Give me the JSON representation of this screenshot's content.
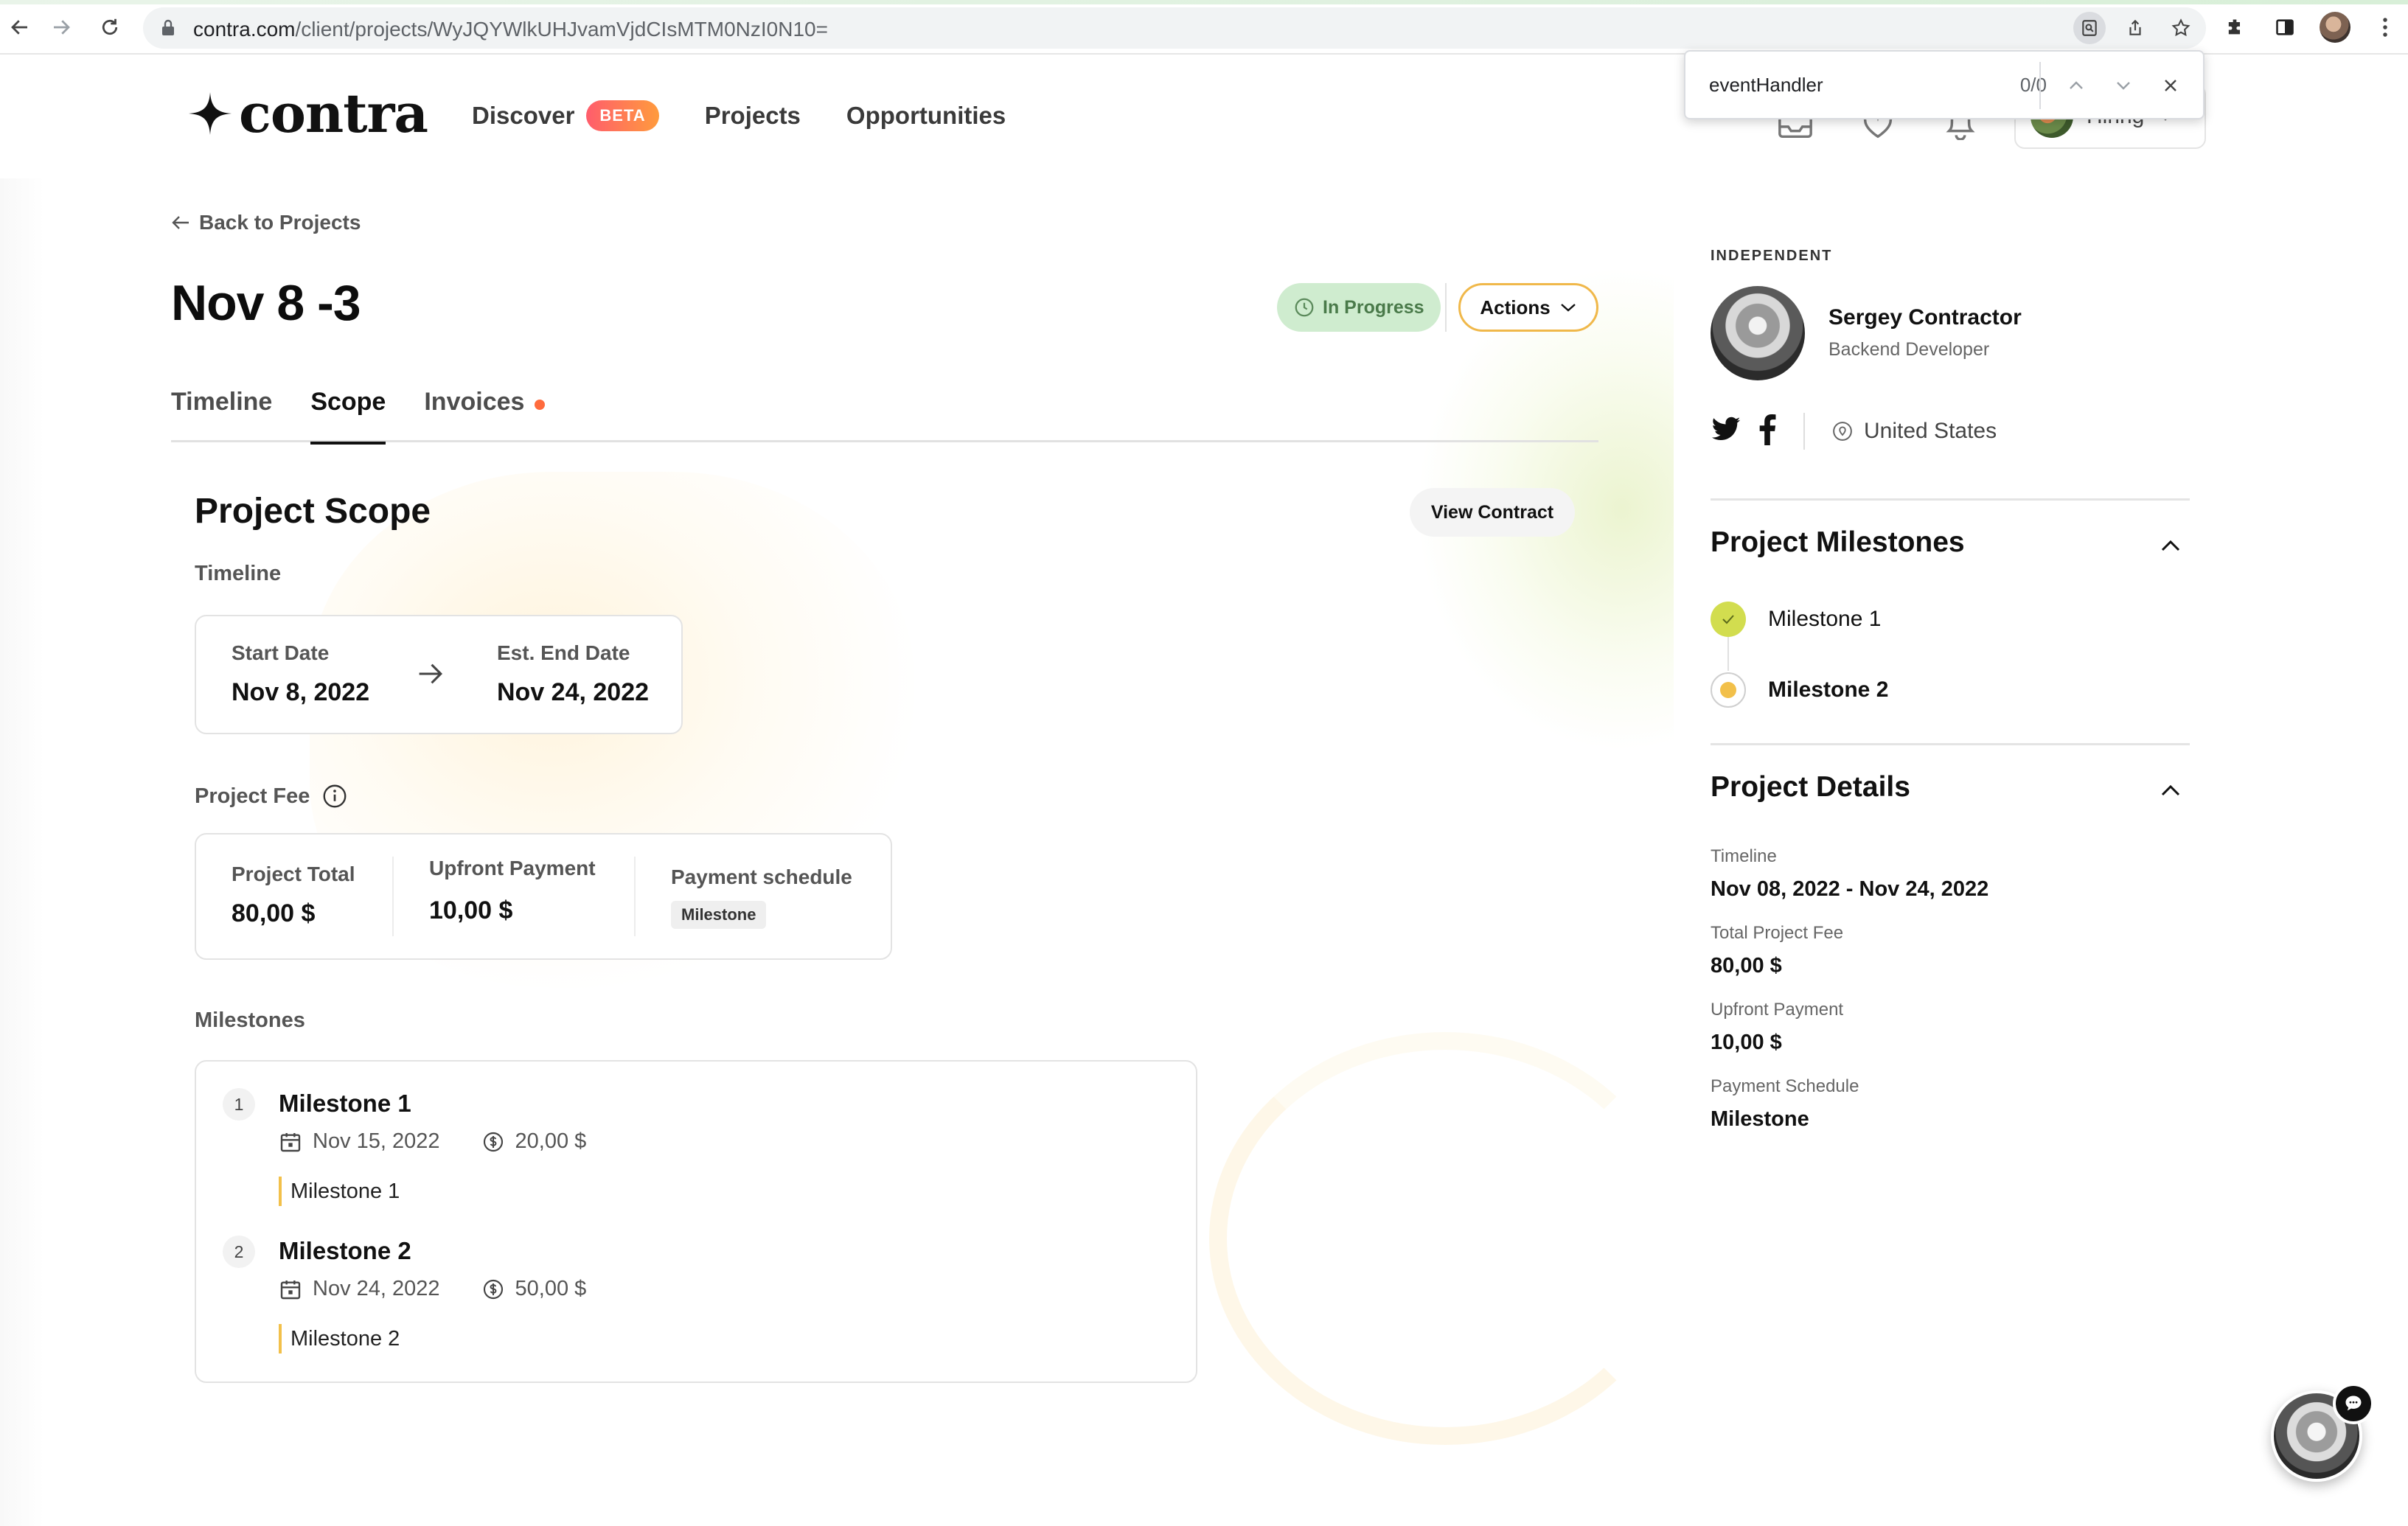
{
  "browser": {
    "url_host": "contra.com",
    "url_path": "/client/projects/WyJQYWlkUHJvamVjdCIsMTM0NzI0N10="
  },
  "find_bar": {
    "query": "eventHandler",
    "count": "0/0"
  },
  "header": {
    "logo_text": "contra",
    "nav": {
      "discover": "Discover",
      "beta": "BETA",
      "projects": "Projects",
      "opportunities": "Opportunities"
    },
    "account_label": "Hiring"
  },
  "page": {
    "back_link": "Back to Projects",
    "title": "Nov 8 -3",
    "status": "In Progress",
    "actions": "Actions",
    "tabs": [
      "Timeline",
      "Scope",
      "Invoices"
    ],
    "active_tab": "Scope"
  },
  "scope": {
    "title": "Project Scope",
    "view_contract": "View Contract",
    "timeline_label": "Timeline",
    "start_label": "Start Date",
    "start_value": "Nov 8, 2022",
    "end_label": "Est. End Date",
    "end_value": "Nov 24, 2022",
    "fee_label": "Project Fee",
    "total_label": "Project Total",
    "total_value": "80,00 $",
    "upfront_label": "Upfront Payment",
    "upfront_value": "10,00 $",
    "schedule_label": "Payment schedule",
    "schedule_value": "Milestone",
    "milestones_label": "Milestones",
    "milestones": [
      {
        "num": "1",
        "title": "Milestone 1",
        "date": "Nov 15, 2022",
        "amount": "20,00 $",
        "desc": "Milestone 1"
      },
      {
        "num": "2",
        "title": "Milestone 2",
        "date": "Nov 24, 2022",
        "amount": "50,00 $",
        "desc": "Milestone 2"
      }
    ]
  },
  "sidebar": {
    "independent": "INDEPENDENT",
    "name": "Sergey Contractor",
    "role": "Backend Developer",
    "location": "United States",
    "milestones_title": "Project Milestones",
    "milestones": [
      {
        "label": "Milestone 1",
        "state": "done"
      },
      {
        "label": "Milestone 2",
        "state": "current"
      }
    ],
    "details_title": "Project Details",
    "details": [
      {
        "label": "Timeline",
        "value": "Nov 08, 2022 - Nov 24, 2022"
      },
      {
        "label": "Total Project Fee",
        "value": "80,00 $"
      },
      {
        "label": "Upfront Payment",
        "value": "10,00 $"
      },
      {
        "label": "Payment Schedule",
        "value": "Milestone"
      }
    ]
  },
  "colors": {
    "status_bg": "#cfeccf",
    "actions_border": "#f0b84a",
    "milestone_done": "#d2dd4f",
    "milestone_current": "#f2c04a",
    "invoice_dot": "#ff6b3d"
  }
}
